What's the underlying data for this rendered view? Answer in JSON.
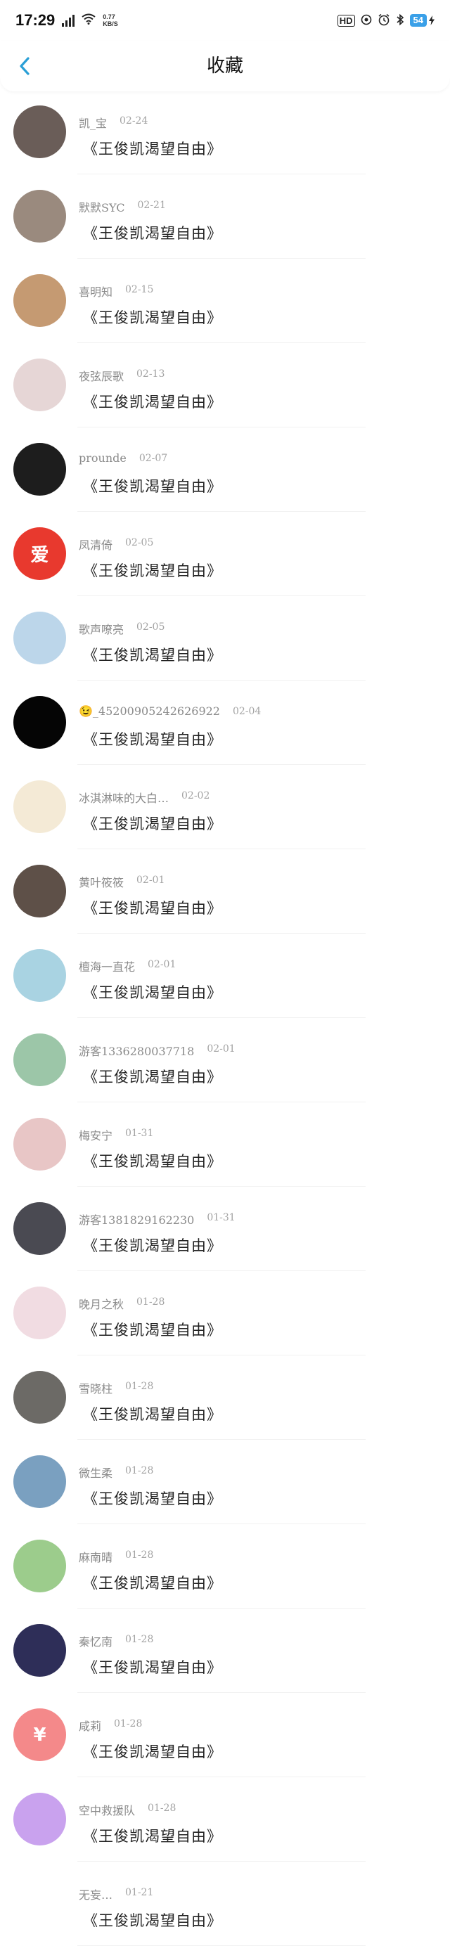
{
  "status_bar": {
    "time": "17:29",
    "net_speed": "0.77",
    "net_unit": "KB/S",
    "hd_label": "HD",
    "battery": "54"
  },
  "nav": {
    "title": "收藏"
  },
  "items": [
    {
      "name": "凯_宝",
      "date": "02-24",
      "book": "《王俊凯渴望自由》",
      "avatar_color": "#6a5d58"
    },
    {
      "name": "默默SYC",
      "date": "02-21",
      "book": "《王俊凯渴望自由》",
      "avatar_color": "#9a8a7e"
    },
    {
      "name": "喜明知",
      "date": "02-15",
      "book": "《王俊凯渴望自由》",
      "avatar_color": "#c59a72"
    },
    {
      "name": "夜弦辰歌",
      "date": "02-13",
      "book": "《王俊凯渴望自由》",
      "avatar_color": "#e6d6d6"
    },
    {
      "name": "prounde",
      "date": "02-07",
      "book": "《王俊凯渴望自由》",
      "avatar_color": "#1d1d1d"
    },
    {
      "name": "凤清倚",
      "date": "02-05",
      "book": "《王俊凯渴望自由》",
      "avatar_color": "#e8392e",
      "avatar_text": "爱"
    },
    {
      "name": "歌声嘹亮",
      "date": "02-05",
      "book": "《王俊凯渴望自由》",
      "avatar_color": "#bcd6ea"
    },
    {
      "name": "😉_45200905242626922",
      "date": "02-04",
      "book": "《王俊凯渴望自由》",
      "avatar_color": "#050505"
    },
    {
      "name": "冰淇淋味的大白…",
      "date": "02-02",
      "book": "《王俊凯渴望自由》",
      "avatar_color": "#f4ead6"
    },
    {
      "name": "黄叶筱筱",
      "date": "02-01",
      "book": "《王俊凯渴望自由》",
      "avatar_color": "#5e5048"
    },
    {
      "name": "檀海一直花",
      "date": "02-01",
      "book": "《王俊凯渴望自由》",
      "avatar_color": "#a9d3e2"
    },
    {
      "name": "游客1336280037718",
      "date": "02-01",
      "book": "《王俊凯渴望自由》",
      "avatar_color": "#9cc6a8"
    },
    {
      "name": "梅安宁",
      "date": "01-31",
      "book": "《王俊凯渴望自由》",
      "avatar_color": "#e8c6c6"
    },
    {
      "name": "游客1381829162230",
      "date": "01-31",
      "book": "《王俊凯渴望自由》",
      "avatar_color": "#4a4a52"
    },
    {
      "name": "晚月之秋",
      "date": "01-28",
      "book": "《王俊凯渴望自由》",
      "avatar_color": "#f1dce2"
    },
    {
      "name": "雪晓柱",
      "date": "01-28",
      "book": "《王俊凯渴望自由》",
      "avatar_color": "#6c6a66"
    },
    {
      "name": "微生柔",
      "date": "01-28",
      "book": "《王俊凯渴望自由》",
      "avatar_color": "#7aa0c0"
    },
    {
      "name": "麻南晴",
      "date": "01-28",
      "book": "《王俊凯渴望自由》",
      "avatar_color": "#9ccc8c"
    },
    {
      "name": "秦忆南",
      "date": "01-28",
      "book": "《王俊凯渴望自由》",
      "avatar_color": "#2e2e58"
    },
    {
      "name": "咸莉",
      "date": "01-28",
      "book": "《王俊凯渴望自由》",
      "avatar_color": "#f4898a",
      "avatar_text": "¥"
    },
    {
      "name": "空中救援队",
      "date": "01-28",
      "book": "《王俊凯渴望自由》",
      "avatar_color": "#c9a2ee"
    },
    {
      "name": "无妄…",
      "date": "01-21",
      "book": "《王俊凯渴望自由》",
      "avatar_color": "#ffffff"
    }
  ]
}
